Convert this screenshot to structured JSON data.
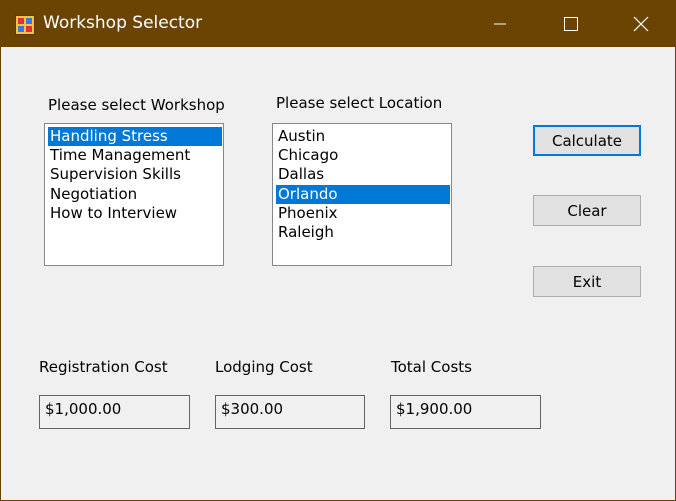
{
  "window": {
    "title": "Workshop Selector",
    "titlebar_color": "#6b4403"
  },
  "workshop": {
    "label": "Please select Workshop",
    "items": [
      "Handling Stress",
      "Time Management",
      "Supervision Skills",
      "Negotiation",
      "How to Interview"
    ],
    "selected": "Handling Stress"
  },
  "location": {
    "label": "Please select Location",
    "items": [
      "Austin",
      "Chicago",
      "Dallas",
      "Orlando",
      "Phoenix",
      "Raleigh"
    ],
    "selected": "Orlando"
  },
  "buttons": {
    "calculate": "Calculate",
    "clear": "Clear",
    "exit": "Exit"
  },
  "costs": {
    "registration_label": "Registration Cost",
    "registration_value": "$1,000.00",
    "lodging_label": "Lodging Cost",
    "lodging_value": "$300.00",
    "total_label": "Total Costs",
    "total_value": "$1,900.00"
  },
  "colors": {
    "selection": "#0078d7"
  }
}
